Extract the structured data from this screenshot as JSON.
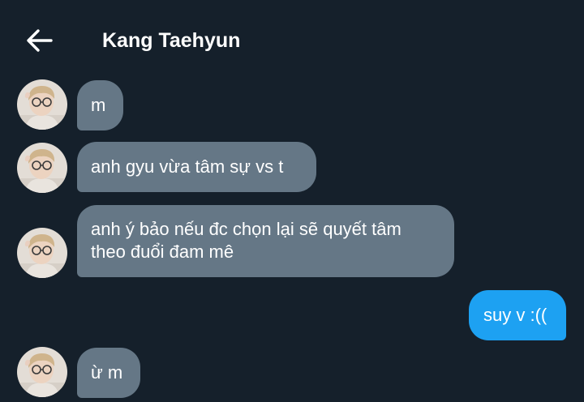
{
  "header": {
    "back_icon": "arrow-left-icon",
    "title": "Kang Taehyun"
  },
  "colors": {
    "background": "#15202b",
    "incoming_bubble": "#657786",
    "outgoing_bubble": "#1da1f2",
    "text": "#ffffff"
  },
  "messages": [
    {
      "direction": "incoming",
      "lines": [
        "m"
      ]
    },
    {
      "direction": "incoming",
      "lines": [
        "anh gyu vừa tâm sự vs t"
      ]
    },
    {
      "direction": "incoming",
      "lines": [
        "anh ý bảo nếu đc chọn lại sẽ quyết tâm",
        "theo đuổi đam mê"
      ]
    },
    {
      "direction": "outgoing",
      "lines": [
        "suy v :(("
      ]
    },
    {
      "direction": "incoming",
      "lines": [
        "ừ m"
      ]
    }
  ]
}
